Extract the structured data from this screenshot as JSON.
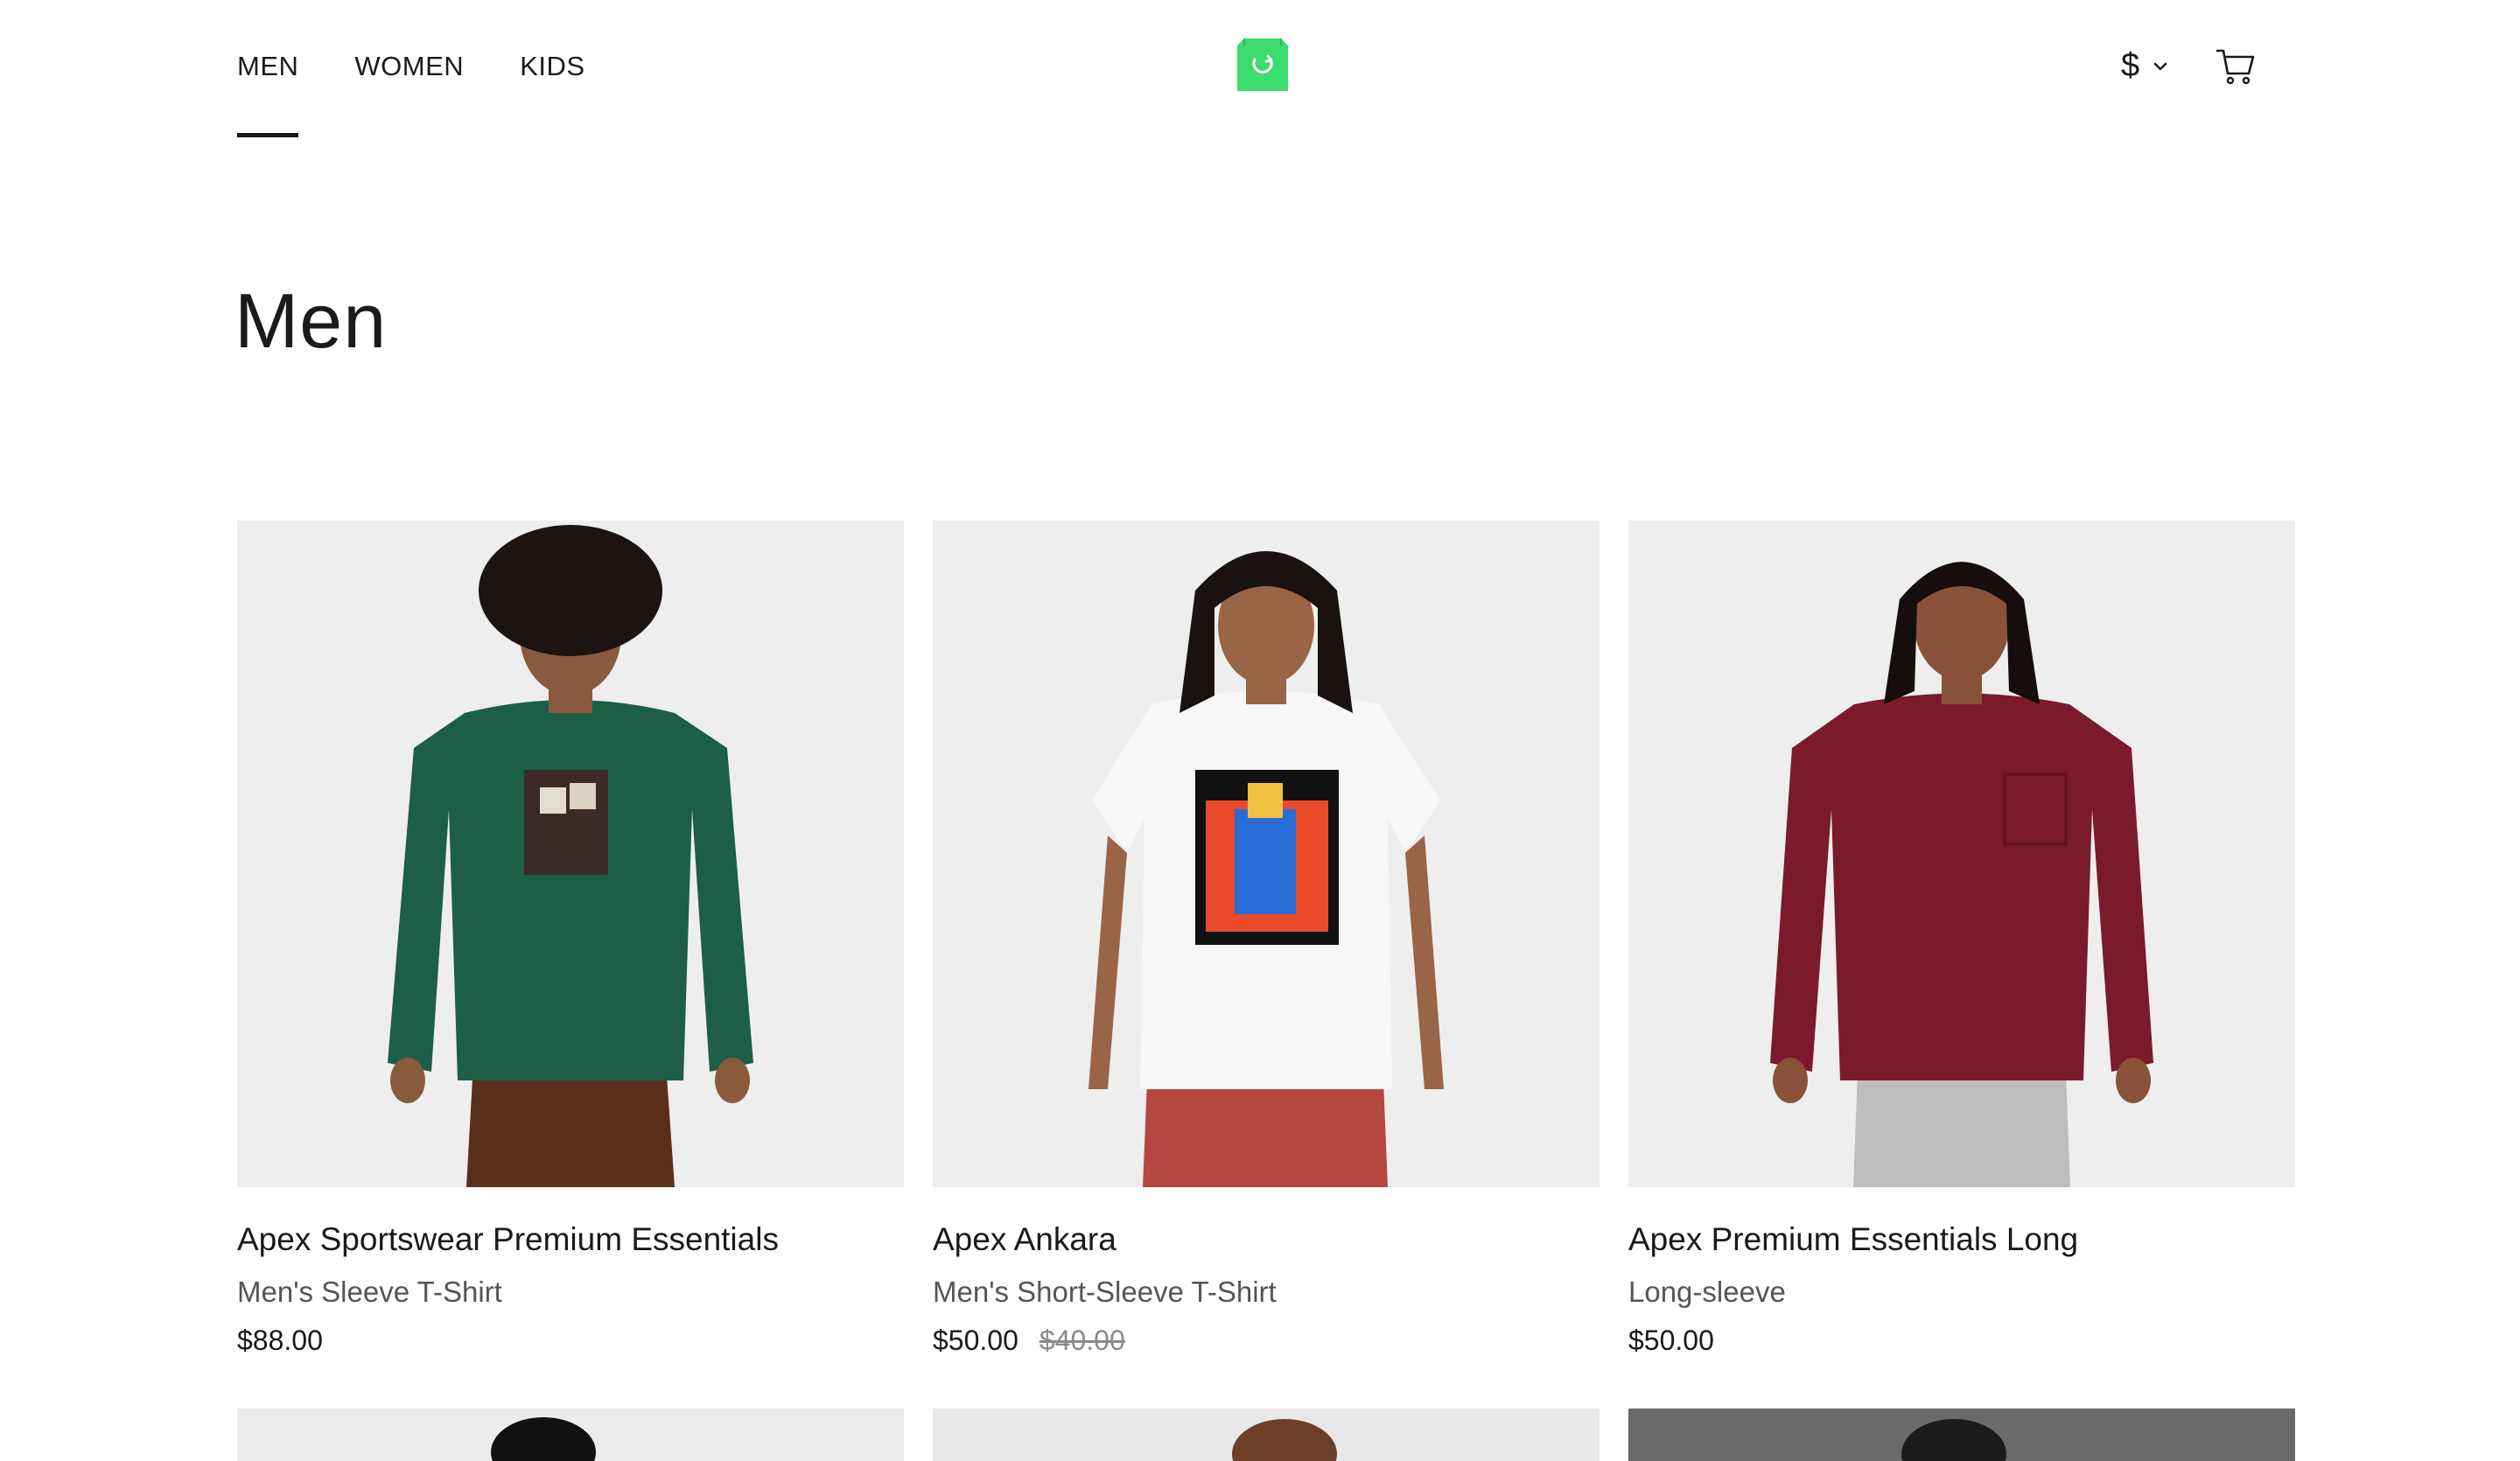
{
  "nav": {
    "items": [
      {
        "label": "MEN",
        "active": true
      },
      {
        "label": "WOMEN",
        "active": false
      },
      {
        "label": "KIDS",
        "active": false
      }
    ]
  },
  "logo": {
    "icon": "shopping-bag-icon",
    "color": "#3ddc6f"
  },
  "currency": {
    "symbol": "$",
    "icon": "chevron-down-icon"
  },
  "cart": {
    "icon": "cart-icon"
  },
  "page": {
    "title": "Men"
  },
  "products": [
    {
      "name": "Apex Sportswear Premium Essentials",
      "subtitle": "Men's Sleeve T-Shirt",
      "price": "$88.00",
      "old_price": "",
      "shirt_color": "#1d5e47",
      "pants_color": "#5a2f1a"
    },
    {
      "name": "Apex Ankara",
      "subtitle": "Men's Short-Sleeve T-Shirt",
      "price": "$50.00",
      "old_price": "$40.00",
      "shirt_color": "#f5f5f5",
      "pants_color": "#b5473f"
    },
    {
      "name": "Apex Premium Essentials Long",
      "subtitle": "Long-sleeve",
      "price": "$50.00",
      "old_price": "",
      "shirt_color": "#7a1a2c",
      "pants_color": "#bdbdbd"
    }
  ],
  "colors": {
    "text": "#1a1a1a",
    "muted": "#555555",
    "strike": "#8a8a8a",
    "image_bg": "#eeeeee",
    "accent": "#3ddc6f"
  }
}
